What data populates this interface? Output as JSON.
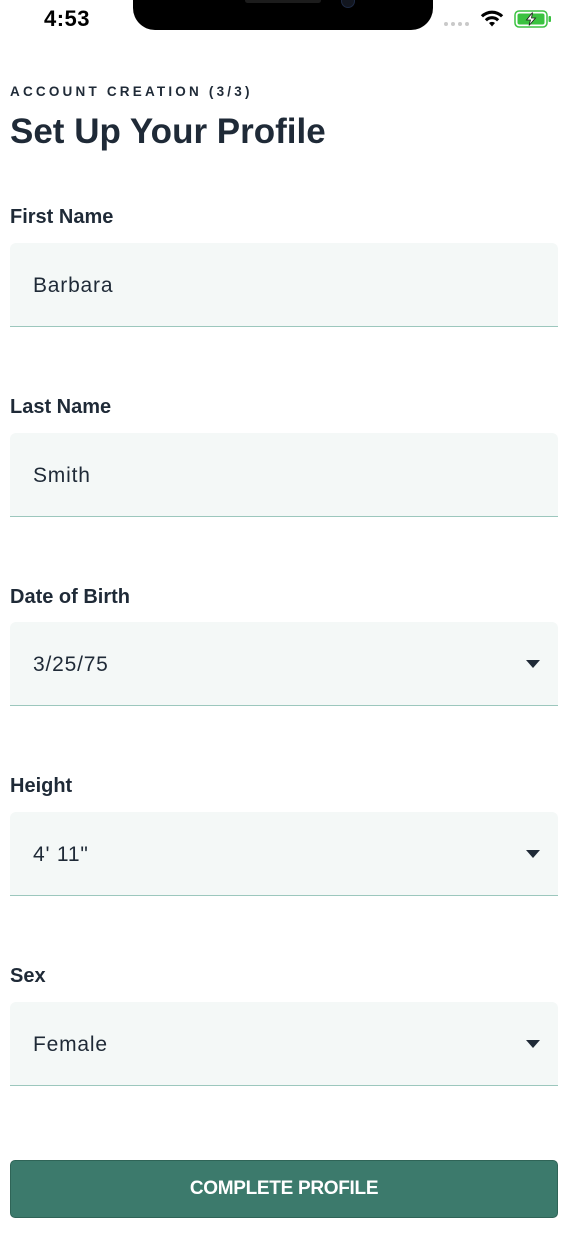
{
  "status_bar": {
    "time": "4:53",
    "icons": [
      "signal-dots-icon",
      "wifi-icon",
      "battery-charging-icon"
    ],
    "battery_color": "#3ac240"
  },
  "header": {
    "step_label": "ACCOUNT CREATION (3/3)",
    "title": "Set Up Your Profile"
  },
  "form": {
    "first_name": {
      "label": "First Name",
      "value": "Barbara"
    },
    "last_name": {
      "label": "Last Name",
      "value": "Smith"
    },
    "date_of_birth": {
      "label": "Date of Birth",
      "value": "3/25/75",
      "icon": "dropdown-caret-icon"
    },
    "height": {
      "label": "Height",
      "value": "4' 11\"",
      "icon": "dropdown-caret-icon"
    },
    "sex": {
      "label": "Sex",
      "value": "Female",
      "icon": "dropdown-caret-icon"
    }
  },
  "actions": {
    "complete_label": "COMPLETE PROFILE"
  },
  "colors": {
    "primary": "#3c7a6c",
    "field_background": "#f4f8f7",
    "field_underline": "#9cc7bd",
    "text": "#1f2a37"
  }
}
